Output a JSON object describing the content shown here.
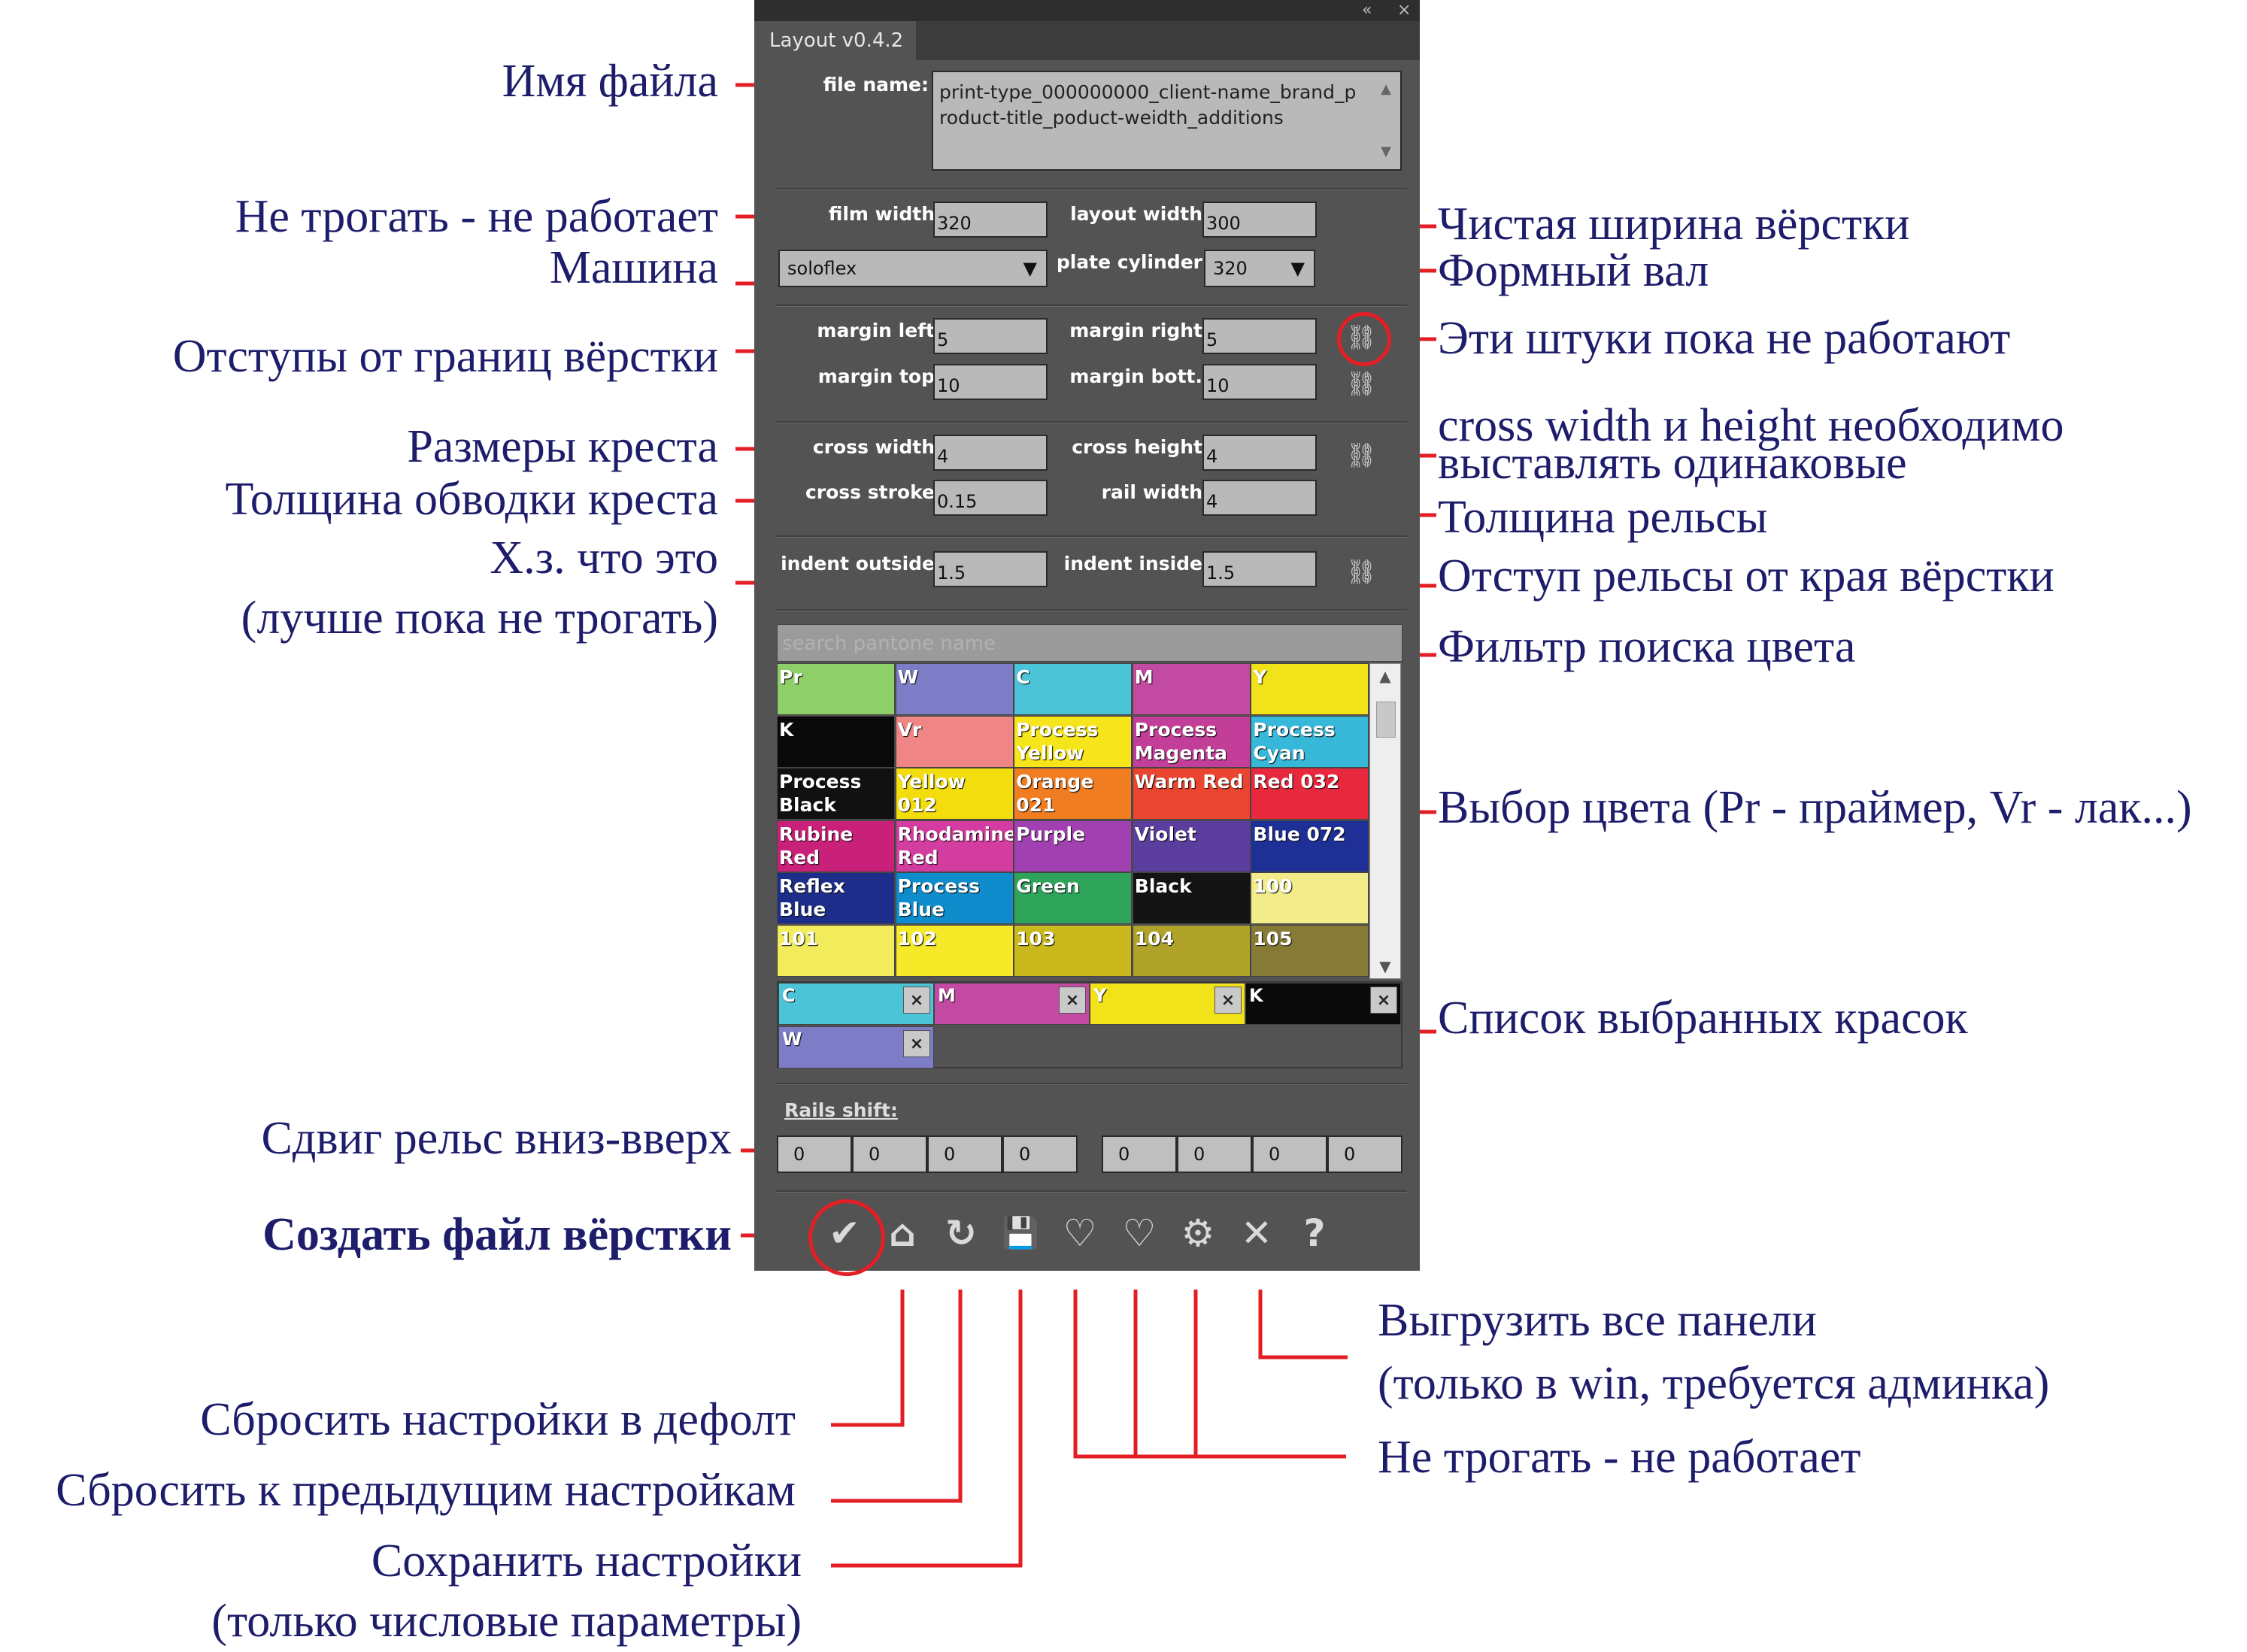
{
  "panel": {
    "tab_title": "Layout v0.4.2",
    "topbar_icons": {
      "collapse": "«",
      "close": "×"
    },
    "file_name_label": "file name:",
    "file_name_value": "print-type_000000000_client-name_brand_product-title_poduct-weidth_additions",
    "film_width_label": "film width",
    "film_width_value": "320",
    "layout_width_label": "layout width",
    "layout_width_value": "300",
    "machine_value": "soloflex",
    "plate_cylinder_label": "plate cylinder",
    "plate_cylinder_value": "320",
    "margin_left_label": "margin left",
    "margin_left_value": "5",
    "margin_right_label": "margin right",
    "margin_right_value": "5",
    "margin_top_label": "margin top",
    "margin_top_value": "10",
    "margin_bott_label": "margin bott.",
    "margin_bott_value": "10",
    "cross_width_label": "cross width",
    "cross_width_value": "4",
    "cross_height_label": "cross height",
    "cross_height_value": "4",
    "cross_stroke_label": "cross stroke",
    "cross_stroke_value": "0.15",
    "rail_width_label": "rail width",
    "rail_width_value": "4",
    "indent_outside_label": "indent outside",
    "indent_outside_value": "1.5",
    "indent_inside_label": "indent inside",
    "indent_inside_value": "1.5",
    "search_placeholder": "search pantone name",
    "swatches": [
      {
        "name": "Pr",
        "color": "#8fcf6a"
      },
      {
        "name": "W",
        "color": "#7d7cc7"
      },
      {
        "name": "C",
        "color": "#4cc4d8"
      },
      {
        "name": "M",
        "color": "#c34aa2"
      },
      {
        "name": "Y",
        "color": "#f2e21a"
      },
      {
        "name": "K",
        "color": "#0a0a0a"
      },
      {
        "name": "Vr",
        "color": "#f08585"
      },
      {
        "name": "Process Yellow",
        "color": "#f6e51a"
      },
      {
        "name": "Process Magenta",
        "color": "#c33e98"
      },
      {
        "name": "Process Cyan",
        "color": "#38b8d8"
      },
      {
        "name": "Process Black",
        "color": "#111111"
      },
      {
        "name": "Yellow 012",
        "color": "#f4dd0c"
      },
      {
        "name": "Orange 021",
        "color": "#f07d22"
      },
      {
        "name": "Warm Red",
        "color": "#ea4530"
      },
      {
        "name": "Red 032",
        "color": "#e8283c"
      },
      {
        "name": "Rubine Red",
        "color": "#c9207a"
      },
      {
        "name": "Rhodamine Red",
        "color": "#d33da0"
      },
      {
        "name": "Purple",
        "color": "#a140b0"
      },
      {
        "name": "Violet",
        "color": "#5b3d9e"
      },
      {
        "name": "Blue 072",
        "color": "#1e2f96"
      },
      {
        "name": "Reflex Blue",
        "color": "#1d2e8a"
      },
      {
        "name": "Process Blue",
        "color": "#0f8ccb"
      },
      {
        "name": "Green",
        "color": "#2ea35a"
      },
      {
        "name": "Black",
        "color": "#141414"
      },
      {
        "name": "100",
        "color": "#f2ed8a"
      },
      {
        "name": "101",
        "color": "#f2ec5c"
      },
      {
        "name": "102",
        "color": "#f6e928"
      },
      {
        "name": "103",
        "color": "#c9b91c"
      },
      {
        "name": "104",
        "color": "#b0a32a"
      },
      {
        "name": "105",
        "color": "#857b37"
      }
    ],
    "chosen_inks": [
      {
        "name": "C",
        "color": "#4cc4d8"
      },
      {
        "name": "M",
        "color": "#c34aa2"
      },
      {
        "name": "Y",
        "color": "#f2e21a"
      },
      {
        "name": "K",
        "color": "#0a0a0a"
      },
      {
        "name": "W",
        "color": "#7d7cc7"
      }
    ],
    "remove_glyph": "×",
    "rails_shift_label": "Rails shift:",
    "rails_shift_values": [
      "0",
      "0",
      "0",
      "0",
      "0",
      "0",
      "0",
      "0"
    ],
    "toolbar": {
      "create": "✔",
      "home": "⌂",
      "reset": "↻",
      "save": "💾",
      "fav_add": "♡",
      "fav": "♡",
      "settings": "⚙",
      "unload": "✕",
      "help": "?"
    },
    "link_glyph": "⛓"
  },
  "annotations": {
    "file_name": "Имя файла",
    "film_width": "Не трогать - не работает",
    "machine": "Машина",
    "margins": "Отступы от границ вёрстки",
    "cross_size": "Размеры креста",
    "cross_stroke": "Толщина обводки креста",
    "indent_outside_1": "Х.з. что это",
    "indent_outside_2": "(лучше пока не трогать)",
    "rails_shift": "Сдвиг рельс вниз-вверх",
    "create_file": "Создать файл вёрстки",
    "layout_width": "Чистая ширина вёрстки",
    "plate_cylinder": "Формный вал",
    "link_icons": "Эти штуки пока не работают",
    "cross_equal_1": "cross width и height необходимо",
    "cross_equal_2": "выставлять одинаковые",
    "rail_width": "Толщина рельсы",
    "indent_inside": "Отступ рельсы от края вёрстки",
    "search": "Фильтр поиска цвета",
    "swatches": "Выбор цвета (Pr - праймер, Vr - лак...)",
    "chosen": "Список выбранных красок",
    "unload_1": "Выгрузить все панели",
    "unload_2": "(только в win, требуется админка)",
    "dont_touch": "Не трогать - не работает",
    "reset_default": "Сбросить настройки в дефолт",
    "reset_prev": "Сбросить к предыдущим настройкам",
    "save_1": "Сохранить настройки",
    "save_2": "(только числовые параметры)"
  },
  "accent_colors": {
    "leader_line": "#e31e24",
    "annotation_text": "#1d1d6b",
    "panel_bg": "#535353"
  }
}
